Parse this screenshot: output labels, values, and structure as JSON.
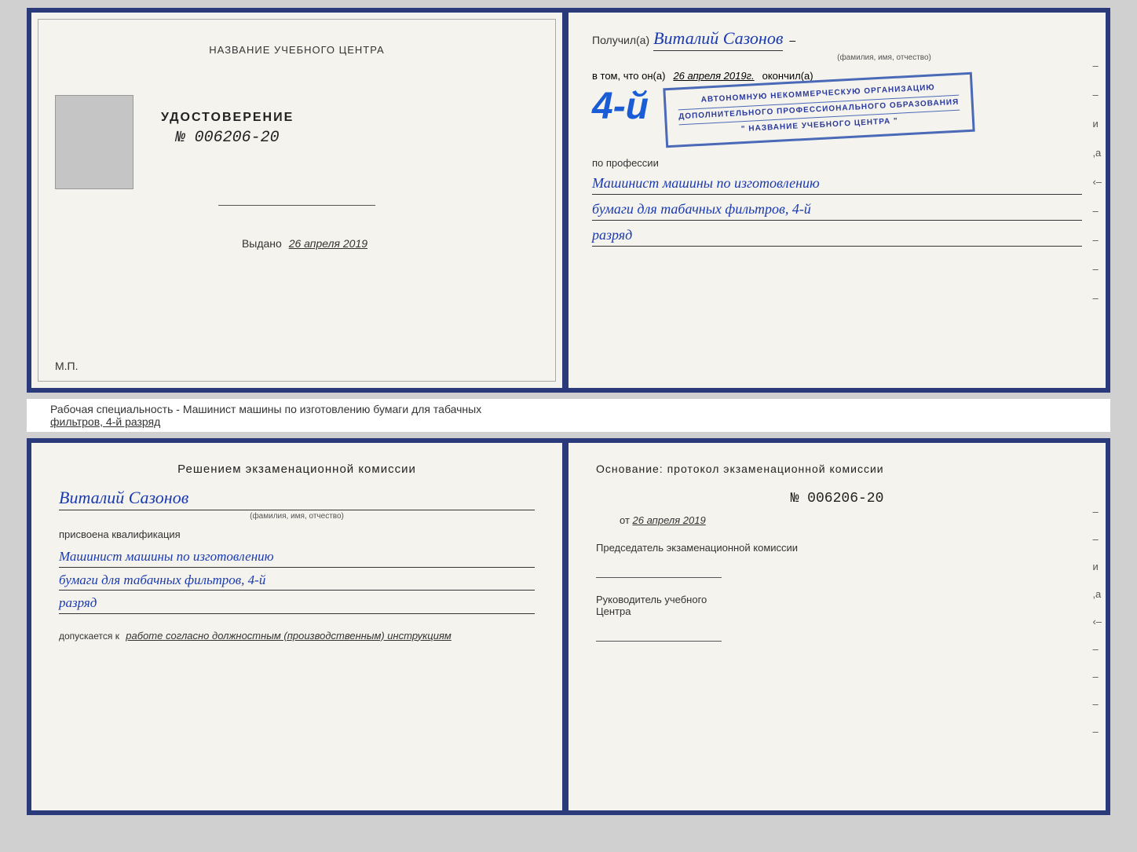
{
  "top_doc": {
    "left": {
      "org_name": "НАЗВАНИЕ УЧЕБНОГО ЦЕНТРА",
      "cert_title": "УДОСТОВЕРЕНИЕ",
      "cert_number": "№ 006206-20",
      "issued_label": "Выдано",
      "issued_date": "26 апреля 2019",
      "mp_label": "М.П."
    },
    "right": {
      "received_prefix": "Получил(а)",
      "received_name": "Виталий Сазонов",
      "name_sub": "(фамилия, имя, отчество)",
      "dash": "–",
      "content_prefix": "в том, что он(а)",
      "content_date": "26 апреля 2019г.",
      "finished_label": "окончил(а)",
      "stamp_line1": "АВТОНОМНУЮ НЕКОММЕРЧЕСКУЮ ОРГАНИЗАЦИЮ",
      "stamp_line2": "ДОПОЛНИТЕЛЬНОГО ПРОФЕССИОНАЛЬНОГО ОБРАЗОВАНИЯ",
      "stamp_line3": "\" НАЗВАНИЕ УЧЕБНОГО ЦЕНТРА \"",
      "num_big": "4-й",
      "profession_label": "по профессии",
      "profession_line1": "Машинист машины по изготовлению",
      "profession_line2": "бумаги для табачных фильтров, 4-й",
      "profession_line3": "разряд",
      "side_dashes": [
        "–",
        "–",
        "и",
        ",а",
        "‹–",
        "–",
        "–",
        "–",
        "–"
      ]
    }
  },
  "bottom_bar": {
    "text_normal": "Рабочая специальность - Машинист машины по изготовлению бумаги для табачных",
    "text_underlined": "фильтров, 4-й разряд"
  },
  "bottom_doc": {
    "left": {
      "commission_title": "Решением  экзаменационной  комиссии",
      "person_name": "Виталий Сазонов",
      "name_sub": "(фамилия, имя, отчество)",
      "assigned_label": "присвоена квалификация",
      "qual_line1": "Машинист машины по изготовлению",
      "qual_line2": "бумаги для табачных фильтров, 4-й",
      "qual_line3": "разряд",
      "allowed_prefix": "допускается к",
      "allowed_italic": "работе согласно должностным (производственным) инструкциям"
    },
    "right": {
      "basis_label": "Основание: протокол экзаменационной  комиссии",
      "protocol_number": "№  006206-20",
      "from_label": "от",
      "from_date": "26 апреля 2019",
      "chair_title": "Председатель экзаменационной комиссии",
      "head_title1": "Руководитель учебного",
      "head_title2": "Центра",
      "side_dashes": [
        "–",
        "–",
        "и",
        ",а",
        "‹–",
        "–",
        "–",
        "–",
        "–"
      ]
    }
  }
}
